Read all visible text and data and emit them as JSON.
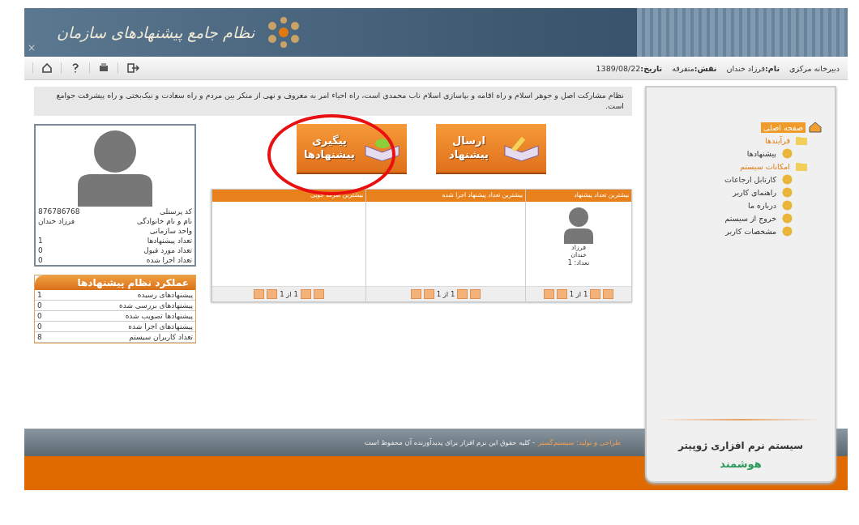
{
  "header": {
    "logo_text": "نظام جامع پیشنهادهای سازمان",
    "close": "×"
  },
  "toolbar": {
    "info": [
      {
        "value": "دبیرخانه مرکزی"
      },
      {
        "label": "نام:",
        "value": "فرزاد خندان"
      },
      {
        "label": "نقش:",
        "value": "متفرقه"
      },
      {
        "label": "تاریخ:",
        "value": "1389/08/22"
      }
    ]
  },
  "motto": "نظام مشارکت اصل و جوهر اسلام و راه اقامه و بپاسازی اسلام ناب محمدی است، راه احیاء امر به معروف و نهی از منکر بین مردم و راه سعادت و نیک‌بختی و راه پیشرفت جوامع است.",
  "action_buttons": [
    {
      "label": "ارسال پیشنهاد",
      "highlighted": false
    },
    {
      "label": "پیگیری پیشنهادها",
      "highlighted": true
    }
  ],
  "top_table": {
    "columns": [
      {
        "title": "بیشترین تعداد پیشنهاد",
        "person": {
          "first": "فرزاد",
          "last": "خندان",
          "count": "تعداد: 1"
        },
        "pager": "1 از 1"
      },
      {
        "title": "بیشترین تعداد پیشنهاد اجرا شده",
        "pager": "1 از 1"
      },
      {
        "title": "بیشترین صرفه جویی",
        "pager": "1 از 1"
      }
    ]
  },
  "profile": {
    "rows": [
      {
        "label": "کد پرسنلی",
        "value": "876786768"
      },
      {
        "label": "نام و نام خانوادگی",
        "value": "فرزاد خندان"
      },
      {
        "label": "واحد سازمانی"
      },
      {
        "label": "تعداد پیشنهادها",
        "value": "1"
      },
      {
        "label": "تعداد مورد قبول",
        "value": "0"
      },
      {
        "label": "تعداد اجرا شده",
        "value": "0"
      }
    ]
  },
  "performance": {
    "title": "عملکرد نظام پیشنهادها",
    "rows": [
      {
        "label": "پیشنهادهای رسیده",
        "value": "1"
      },
      {
        "label": "پیشنهادهای بررسی شده",
        "value": "0"
      },
      {
        "label": "پیشنهادها تصویب شده",
        "value": "0"
      },
      {
        "label": "پیشنهادهای اجرا شده",
        "value": "0"
      },
      {
        "label": "تعداد کاربران سیستم",
        "value": "8"
      }
    ]
  },
  "sidebar": {
    "tree": [
      {
        "label": "صفحه اصلی",
        "selected": true,
        "children": [
          {
            "label": "فرآیندها",
            "selected": false,
            "children": [
              {
                "label": "پیشنهادها",
                "selected": false
              }
            ]
          },
          {
            "label": "امکانات سیستم",
            "selected": false,
            "children": [
              {
                "label": "کارتابل ارجاعات",
                "selected": false
              },
              {
                "label": "راهنمای کاربر",
                "selected": false
              },
              {
                "label": "درباره ما",
                "selected": false
              },
              {
                "label": "خروج از سیستم",
                "selected": false
              },
              {
                "label": "مشخصات کاربر",
                "selected": false
              }
            ]
          }
        ]
      }
    ],
    "product": "سیستم نرم افزاری ژوپیتر",
    "product_tag": "هوشمند"
  },
  "footer": {
    "credit": "طراحی و تولید: سیستم‌گستر",
    "rights": "- کلیه حقوق این نرم افزار برای پدیدآورنده آن محفوظ است"
  }
}
